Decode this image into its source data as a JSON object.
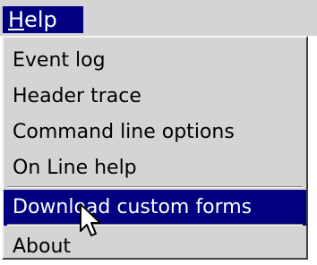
{
  "menubar": {
    "title_mnemonic": "H",
    "title_rest": "elp"
  },
  "menu": {
    "items": [
      {
        "label": "Event log"
      },
      {
        "label": "Header trace"
      },
      {
        "label": "Command line options"
      },
      {
        "label": "On Line help"
      },
      {
        "label": "Download custom forms"
      },
      {
        "label": "About"
      }
    ],
    "highlighted_item": "Download custom forms"
  },
  "colors": {
    "menu_background": "#d4d4d4",
    "highlight": "#000080",
    "highlight_text": "#ffffff"
  }
}
